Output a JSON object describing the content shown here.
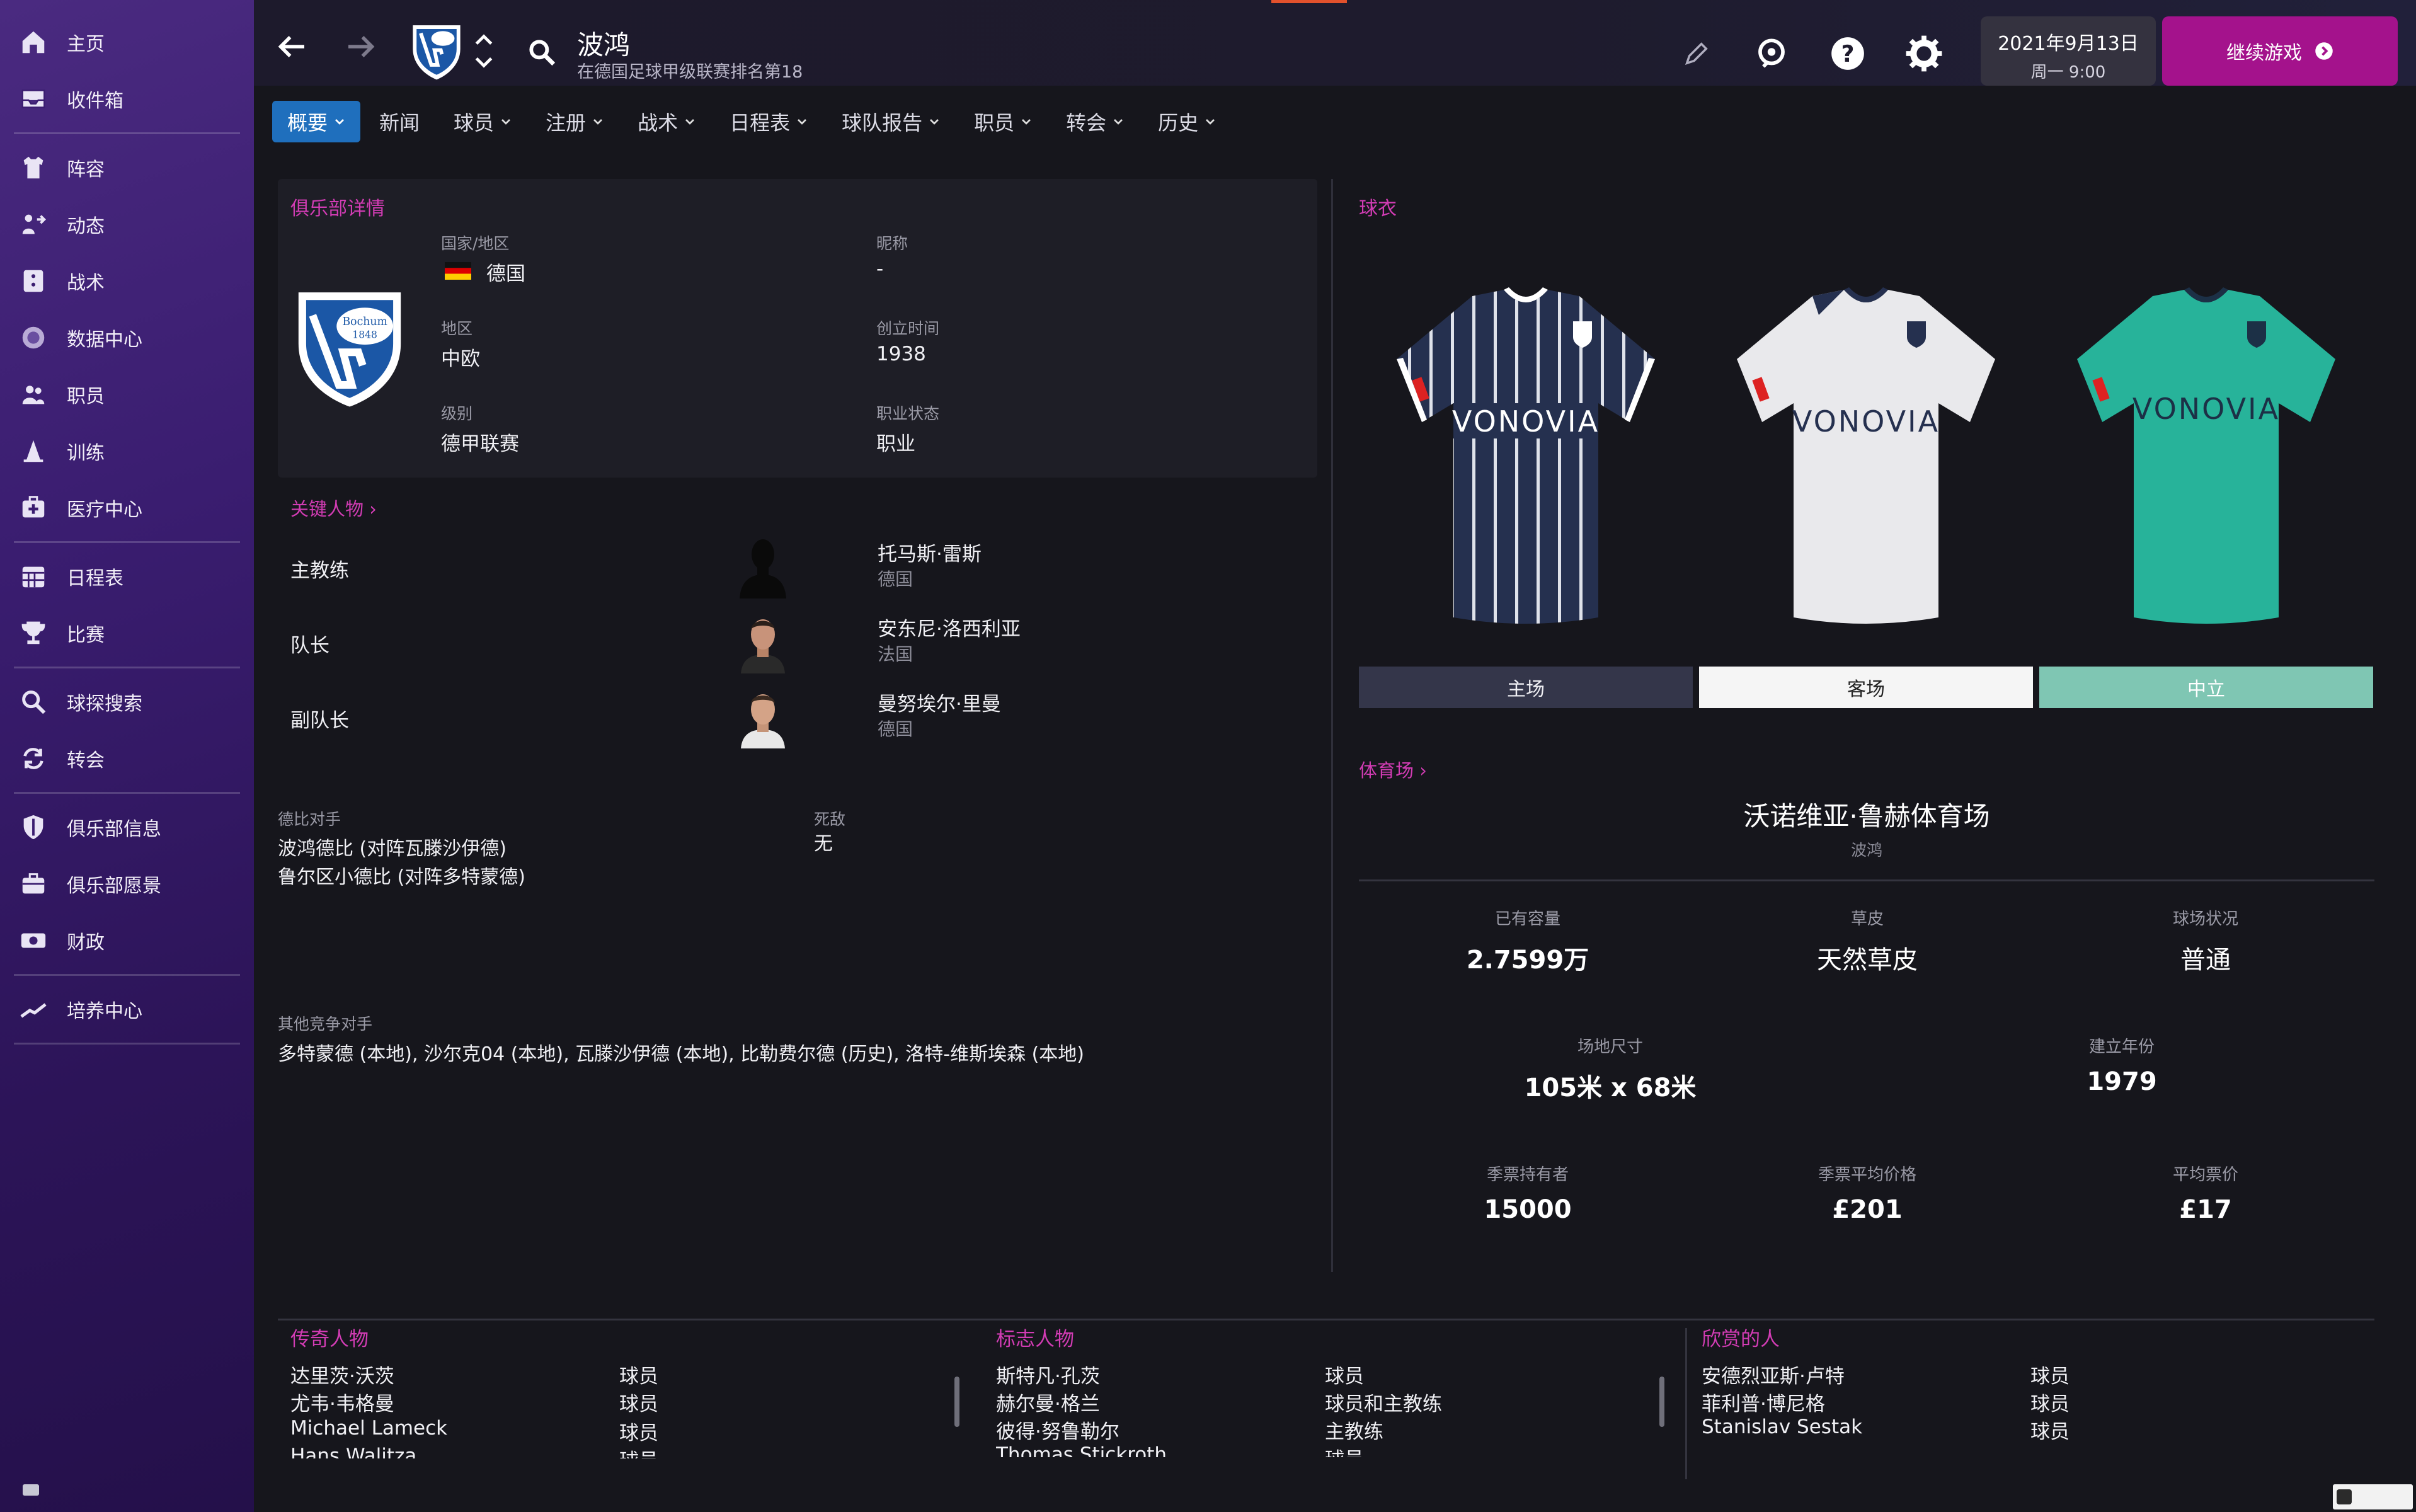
{
  "sidebar": {
    "groups": [
      [
        {
          "label": "主页",
          "icon": "home-icon"
        },
        {
          "label": "收件箱",
          "icon": "inbox-icon"
        }
      ],
      [
        {
          "label": "阵容",
          "icon": "shirt-icon"
        },
        {
          "label": "动态",
          "icon": "dynamics-icon"
        },
        {
          "label": "战术",
          "icon": "tactics-icon"
        },
        {
          "label": "数据中心",
          "icon": "data-hub-icon"
        },
        {
          "label": "职员",
          "icon": "staff-icon"
        },
        {
          "label": "训练",
          "icon": "training-icon"
        },
        {
          "label": "医疗中心",
          "icon": "medical-icon"
        }
      ],
      [
        {
          "label": "日程表",
          "icon": "calendar-icon"
        },
        {
          "label": "比赛",
          "icon": "trophy-icon"
        }
      ],
      [
        {
          "label": "球探搜索",
          "icon": "scouting-icon"
        },
        {
          "label": "转会",
          "icon": "transfer-icon"
        }
      ],
      [
        {
          "label": "俱乐部信息",
          "icon": "club-info-icon"
        },
        {
          "label": "俱乐部愿景",
          "icon": "club-vision-icon"
        },
        {
          "label": "财政",
          "icon": "finances-icon"
        }
      ],
      [
        {
          "label": "培养中心",
          "icon": "development-icon"
        }
      ]
    ]
  },
  "header": {
    "club_name": "波鸿",
    "club_subtitle": "在德国足球甲级联赛排名第18",
    "date": "2021年9月13日",
    "time": "周一 9:00",
    "continue_label": "继续游戏"
  },
  "tabs": [
    "概要",
    "新闻",
    "球员",
    "注册",
    "战术",
    "日程表",
    "球队报告",
    "职员",
    "转会",
    "历史"
  ],
  "details": {
    "title": "俱乐部详情",
    "logo_text_1": "Bochum",
    "logo_text_2": "1848",
    "logo_letters": "VfL",
    "country_label": "国家/地区",
    "country": "德国",
    "nickname_label": "昵称",
    "nickname": "-",
    "region_label": "地区",
    "region": "中欧",
    "founded_label": "创立时间",
    "founded": "1938",
    "level_label": "级别",
    "level": "德甲联赛",
    "status_label": "职业状态",
    "status": "职业"
  },
  "key_people": {
    "title": "关键人物",
    "rows": [
      {
        "role": "主教练",
        "name": "托马斯·雷斯",
        "nationality": "德国"
      },
      {
        "role": "队长",
        "name": "安东尼·洛西利亚",
        "nationality": "法国"
      },
      {
        "role": "副队长",
        "name": "曼努埃尔·里曼",
        "nationality": "德国"
      }
    ]
  },
  "derby": {
    "label": "德比对手",
    "items": [
      "波鸿德比 (对阵瓦滕沙伊德)",
      "鲁尔区小德比 (对阵多特蒙德)"
    ],
    "rival_label": "死敌",
    "rival": "无",
    "other_label": "其他竞争对手",
    "other": "多特蒙德 (本地), 沙尔克04 (本地), 瓦滕沙伊德 (本地), 比勒费尔德 (历史), 洛特-维斯埃森 (本地)"
  },
  "kits": {
    "title": "球衣",
    "sponsor": "VONOVIA",
    "items": [
      {
        "label": "主场",
        "color": "#25304f",
        "btn_bg": "#34364a",
        "btn_fg": "#f0f0f4"
      },
      {
        "label": "客场",
        "color": "#e9e9ec",
        "btn_bg": "#f5f5f5",
        "btn_fg": "#222222"
      },
      {
        "label": "中立",
        "color": "#27b39a",
        "btn_bg": "#7fc6b3",
        "btn_fg": "#ffffff"
      }
    ]
  },
  "stadium": {
    "title": "体育场",
    "name": "沃诺维亚·鲁赫体育场",
    "city": "波鸿",
    "stats": [
      {
        "label": "已有容量",
        "value": "2.7599万"
      },
      {
        "label": "草皮",
        "value": "天然草皮"
      },
      {
        "label": "球场状况",
        "value": "普通"
      },
      {
        "label": "场地尺寸",
        "value": "105米 x 68米"
      },
      {
        "label": "建立年份",
        "value": "1979"
      },
      {
        "label": "季票持有者",
        "value": "15000"
      },
      {
        "label": "季票平均价格",
        "value": "£201"
      },
      {
        "label": "平均票价",
        "value": "£17"
      }
    ]
  },
  "legends": {
    "title": "传奇人物",
    "rows": [
      [
        "达里茨·沃茨",
        "球员"
      ],
      [
        "尤韦·韦格曼",
        "球员"
      ],
      [
        "Michael Lameck",
        "球员"
      ],
      [
        "Hans Walitza",
        "球员"
      ]
    ]
  },
  "icons_people": {
    "title": "标志人物",
    "rows": [
      [
        "斯特凡·孔茨",
        "球员"
      ],
      [
        "赫尔曼·格兰",
        "球员和主教练"
      ],
      [
        "彼得·努鲁勒尔",
        "主教练"
      ],
      [
        "Thomas Stickroth",
        "球员"
      ]
    ]
  },
  "favoured": {
    "title": "欣赏的人",
    "rows": [
      [
        "安德烈亚斯·卢特",
        "球员"
      ],
      [
        "菲利普·博尼格",
        "球员"
      ],
      [
        "Stanislav Sestak",
        "球员"
      ]
    ]
  },
  "colors": {
    "accent_magenta": "#d23cb4",
    "tab_active": "#1f6fbd",
    "continue_button": "#a4128c"
  }
}
